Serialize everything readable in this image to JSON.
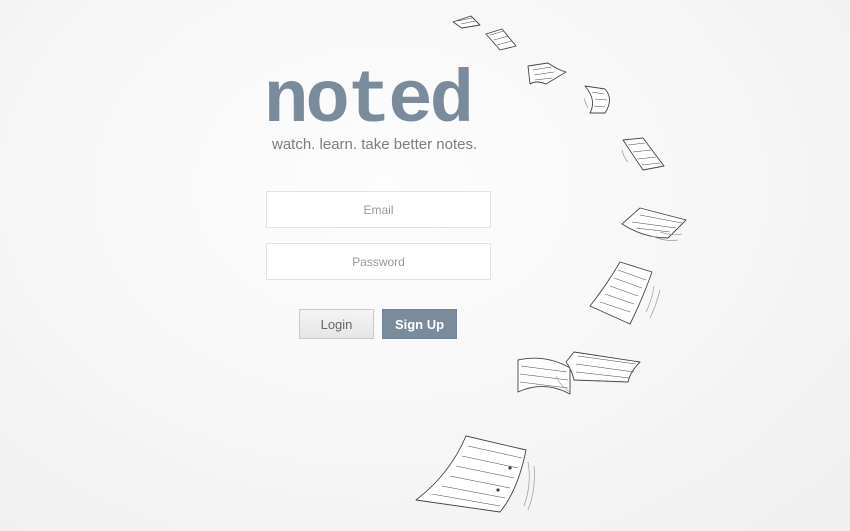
{
  "brand": {
    "logo_text": "noted",
    "tagline": "watch. learn. take better notes."
  },
  "form": {
    "email_placeholder": "Email",
    "password_placeholder": "Password",
    "login_label": "Login",
    "signup_label": "Sign Up"
  },
  "colors": {
    "brand": "#7a8c9c",
    "tagline": "#7d7d7d",
    "background": "#f6f6f6"
  },
  "decoration": {
    "icon": "flying-paper-sheets-illustration"
  }
}
